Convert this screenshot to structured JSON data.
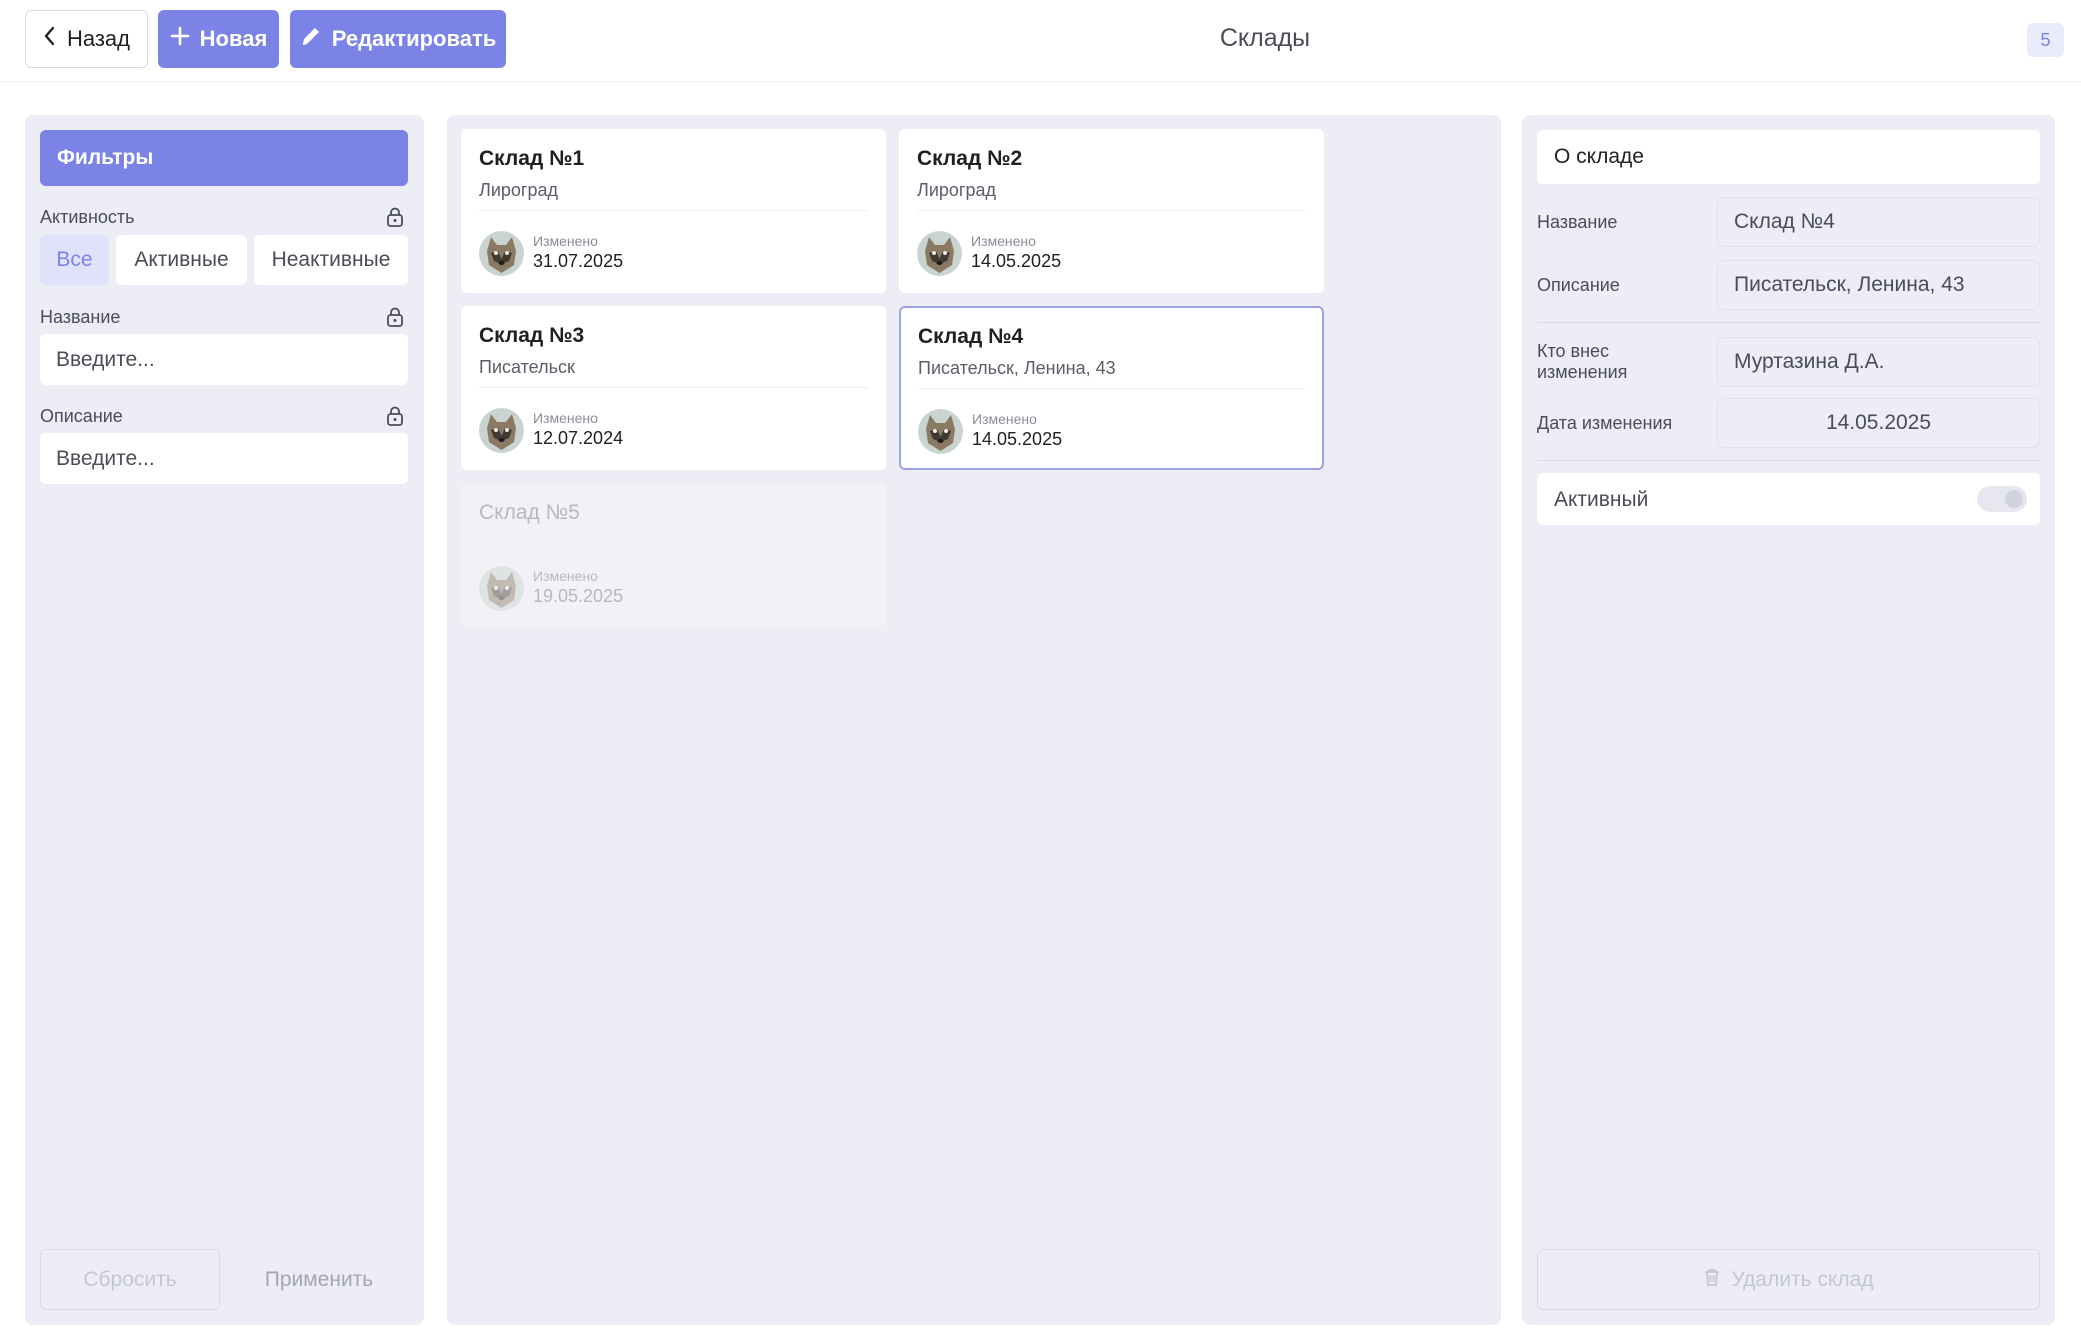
{
  "topbar": {
    "back_label": "Назад",
    "new_label": "Новая",
    "edit_label": "Редактировать",
    "title": "Склады",
    "count": "5"
  },
  "colors": {
    "accent": "#7b84e6",
    "panel_bg": "#ededf6"
  },
  "filters": {
    "header": "Фильтры",
    "activity_label": "Активность",
    "activity_options": [
      "Все",
      "Активные",
      "Неактивные"
    ],
    "activity_selected": "Все",
    "name_label": "Название",
    "name_placeholder": "Введите...",
    "description_label": "Описание",
    "description_placeholder": "Введите...",
    "reset_label": "Сбросить",
    "apply_label": "Применить"
  },
  "warehouses": [
    {
      "title": "Склад №1",
      "subtitle": "Лироград",
      "meta_label": "Изменено",
      "date": "31.07.2025",
      "selected": false,
      "disabled": false
    },
    {
      "title": "Склад №2",
      "subtitle": "Лироград",
      "meta_label": "Изменено",
      "date": "14.05.2025",
      "selected": false,
      "disabled": false
    },
    {
      "title": "Склад №3",
      "subtitle": "Писательск",
      "meta_label": "Изменено",
      "date": "12.07.2024",
      "selected": false,
      "disabled": false
    },
    {
      "title": "Склад №4",
      "subtitle": "Писательск, Ленина, 43",
      "meta_label": "Изменено",
      "date": "14.05.2025",
      "selected": true,
      "disabled": false
    },
    {
      "title": "Склад №5",
      "subtitle": "",
      "meta_label": "Изменено",
      "date": "19.05.2025",
      "selected": false,
      "disabled": true
    }
  ],
  "details": {
    "header": "О складе",
    "name_label": "Название",
    "name_value": "Склад №4",
    "description_label": "Описание",
    "description_value": "Писательск, Ленина, 43",
    "author_label_line1": "Кто внес",
    "author_label_line2": "изменения",
    "author_value": "Муртазина Д.А.",
    "date_label": "Дата изменения",
    "date_value": "14.05.2025",
    "active_label": "Активный",
    "active": false,
    "delete_label": "Удалить склад"
  }
}
